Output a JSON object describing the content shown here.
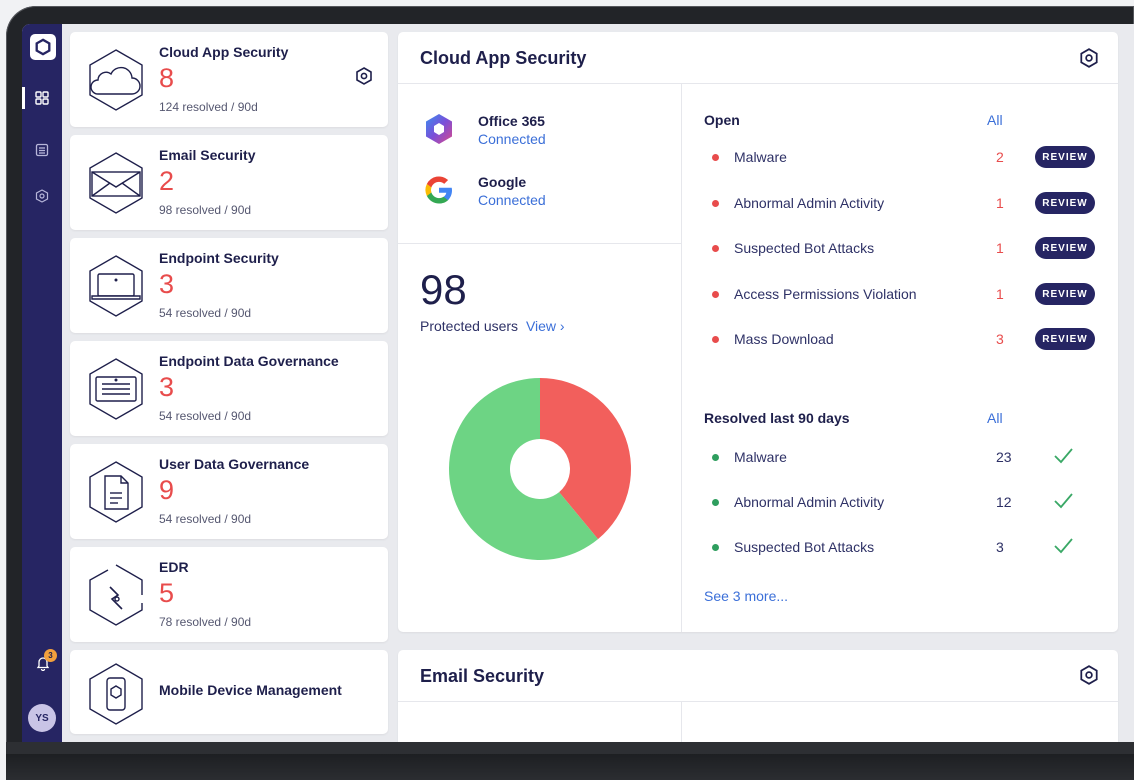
{
  "colors": {
    "brand_navy": "#262563",
    "alert_red": "#e84c4c",
    "ok_green": "#2e9e5e",
    "link_blue": "#3b6fd8",
    "donut_green": "#6dd484",
    "donut_red": "#f25f5c"
  },
  "rail": {
    "logo_icon": "hexagon-logo-icon",
    "items": [
      {
        "name": "dashboard-grid-icon",
        "active": true
      },
      {
        "name": "list-icon",
        "active": false
      },
      {
        "name": "hexagon-target-icon",
        "active": false
      }
    ],
    "notifications_count": "3",
    "avatar_initials": "YS"
  },
  "modules": [
    {
      "title": "Cloud App Security",
      "count": "8",
      "resolved": "124 resolved / 90d",
      "icon": "cloud-hexagon-icon",
      "settings_icon": "hexagon-settings-icon"
    },
    {
      "title": "Email Security",
      "count": "2",
      "resolved": "98 resolved / 90d",
      "icon": "envelope-hexagon-icon"
    },
    {
      "title": "Endpoint Security",
      "count": "3",
      "resolved": "54 resolved / 90d",
      "icon": "laptop-hexagon-icon"
    },
    {
      "title": "Endpoint Data Governance",
      "count": "3",
      "resolved": "54 resolved / 90d",
      "icon": "document-laptop-hexagon-icon"
    },
    {
      "title": "User Data Governance",
      "count": "9",
      "resolved": "54 resolved / 90d",
      "icon": "file-hexagon-icon"
    },
    {
      "title": "EDR",
      "count": "5",
      "resolved": "78 resolved / 90d",
      "icon": "broken-hexagon-icon"
    },
    {
      "title": "Mobile Device Management",
      "icon": "mobile-hexagon-icon"
    }
  ],
  "cloud_panel": {
    "title": "Cloud App Security",
    "integrations": [
      {
        "name": "Office 365",
        "status": "Connected",
        "icon": "office-365-icon"
      },
      {
        "name": "Google",
        "status": "Connected",
        "icon": "google-icon"
      }
    ],
    "protected_users": {
      "count": "98",
      "label": "Protected users",
      "link": "View ›"
    },
    "open": {
      "heading": "Open",
      "all_link": "All",
      "items": [
        {
          "label": "Malware",
          "count": "2",
          "action": "REVIEW"
        },
        {
          "label": "Abnormal Admin Activity",
          "count": "1",
          "action": "REVIEW"
        },
        {
          "label": "Suspected Bot Attacks",
          "count": "1",
          "action": "REVIEW"
        },
        {
          "label": "Access Permissions Violation",
          "count": "1",
          "action": "REVIEW"
        },
        {
          "label": "Mass Download",
          "count": "3",
          "action": "REVIEW"
        }
      ]
    },
    "resolved": {
      "heading": "Resolved last 90 days",
      "all_link": "All",
      "items": [
        {
          "label": "Malware",
          "count": "23"
        },
        {
          "label": "Abnormal Admin Activity",
          "count": "12"
        },
        {
          "label": "Suspected Bot Attacks",
          "count": "3"
        }
      ],
      "see_more": "See 3 more..."
    }
  },
  "email_panel": {
    "title": "Email Security"
  },
  "chart_data": {
    "type": "pie",
    "title": "",
    "donut": true,
    "slices": [
      {
        "value": 0.39,
        "color": "#f25f5c"
      },
      {
        "value": 0.61,
        "color": "#6dd484"
      }
    ]
  }
}
